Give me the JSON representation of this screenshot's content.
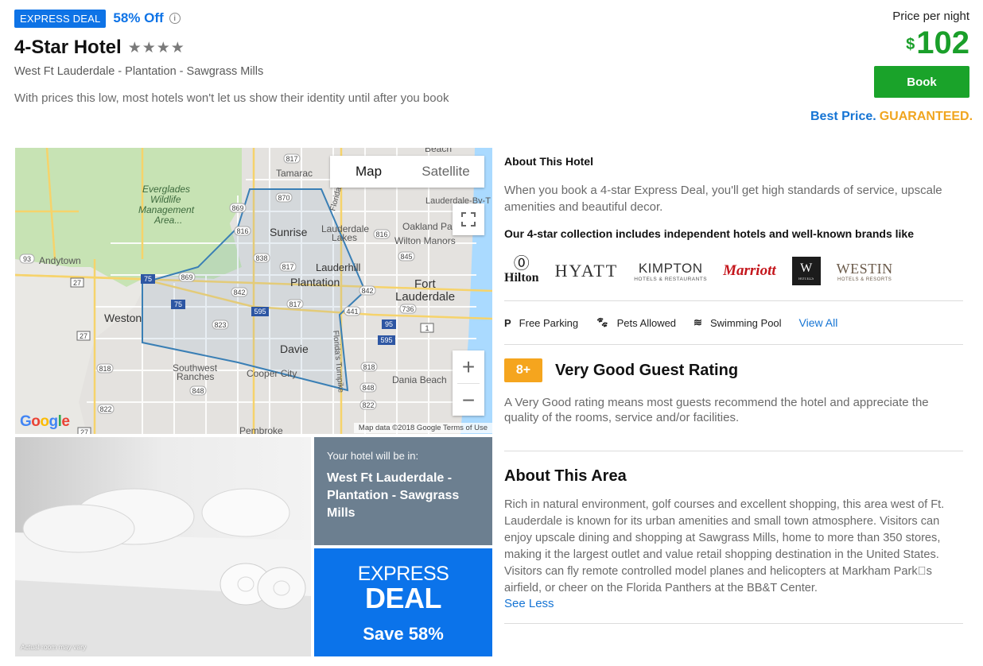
{
  "header": {
    "deal_badge": "EXPRESS DEAL",
    "discount": "58% Off",
    "title": "4-Star Hotel",
    "stars": "★★★★",
    "location": "West Ft Lauderdale - Plantation - Sawgrass Mills",
    "disclaimer": "With prices this low, most hotels won't let us show their identity until after you book"
  },
  "pricing": {
    "label": "Price per night",
    "currency": "$",
    "amount": "102",
    "book_label": "Book",
    "guarantee_1": "Best Price.",
    "guarantee_2": "GUARANTEED."
  },
  "map": {
    "tab_map": "Map",
    "tab_satellite": "Satellite",
    "zoom_in": "+",
    "zoom_out": "−",
    "google_logo": "Google",
    "attribution": "Map data ©2018 Google   Terms of Use",
    "labels": {
      "tamarac": "Tamarac",
      "everglades": "Everglades",
      "wildlife": "Wildlife",
      "management": "Management",
      "area": "Area...",
      "andytown": "Andytown",
      "sunrise": "Sunrise",
      "lauderdale_lakes_1": "Lauderdale",
      "lauderdale_lakes_2": "Lakes",
      "oakland_park": "Oakland Pa",
      "wilton_manors": "Wilton Manors",
      "lauderhill": "Lauderhill",
      "plantation": "Plantation",
      "fort_1": "Fort",
      "fort_2": "Lauderdale",
      "weston": "Weston",
      "davie": "Davie",
      "southwest_1": "Southwest",
      "southwest_2": "Ranches",
      "cooper_city": "Cooper City",
      "dania_beach": "Dania Beach",
      "pembroke": "Pembroke",
      "beach": "Beach",
      "lauderdale_by": "Lauderdale-By-T",
      "florida": "Florida",
      "florida_turnpike": "Florida's Turnpike"
    },
    "shields": {
      "s817a": "817",
      "s870": "870",
      "s869": "869",
      "s816a": "816",
      "s816b": "816",
      "s838": "838",
      "s817b": "817",
      "s869b": "869",
      "s842a": "842",
      "s842b": "842",
      "s75a": "75",
      "s75b": "75",
      "s817c": "817",
      "s595a": "595",
      "s595b": "595",
      "s823": "823",
      "s845": "845",
      "s736": "736",
      "s441": "441",
      "s95": "95",
      "s1": "1",
      "s93": "93",
      "s27a": "27",
      "s27b": "27",
      "s27c": "27",
      "s818a": "818",
      "s818b": "818",
      "s848a": "848",
      "s848b": "848",
      "s822a": "822",
      "s822b": "822"
    }
  },
  "tiles": {
    "room_note": "Actual room may vary",
    "area_small": "Your hotel will be in:",
    "area_big": "West Ft Lauderdale - Plantation - Sawgrass Mills",
    "express_1": "EXPRESS",
    "express_2": "DEAL",
    "express_3": "Save 58%"
  },
  "about": {
    "heading": "About This Hotel",
    "text": "When you book a 4-star Express Deal, you'll get high standards of service, upscale amenities and beautiful decor.",
    "brands_heading": "Our 4-star collection includes independent hotels and well-known brands like",
    "brands": {
      "hilton": "Hilton",
      "hyatt": "HYATT",
      "kimpton": "KIMPTON",
      "kimpton_sub": "HOTELS & RESTAURANTS",
      "marriott": "Marriott",
      "w": "W",
      "w_sub": "HOTELS",
      "westin": "WESTIN",
      "westin_sub": "HOTELS & RESORTS"
    }
  },
  "amenities": {
    "parking": "Free Parking",
    "pets": "Pets Allowed",
    "pool": "Swimming Pool",
    "view_all": "View All"
  },
  "rating": {
    "badge": "8+",
    "title": "Very Good Guest Rating",
    "text": "A Very Good rating means most guests recommend the hotel and appreciate the quality of the rooms, service and/or facilities."
  },
  "area": {
    "heading": "About This Area",
    "text": "Rich in natural environment, golf courses and excellent shopping, this area west of Ft. Lauderdale is known for its urban amenities and small town atmosphere. Visitors can enjoy upscale dining and shopping at Sawgrass Mills, home to more than 350 stores, making it the largest outlet and value retail shopping destination in the United States. Visitors can fly remote controlled model planes and helicopters at Markham Park\u0000s airfield, or cheer on the Florida Panthers at the BB&T Center.",
    "see_less": "See Less"
  }
}
